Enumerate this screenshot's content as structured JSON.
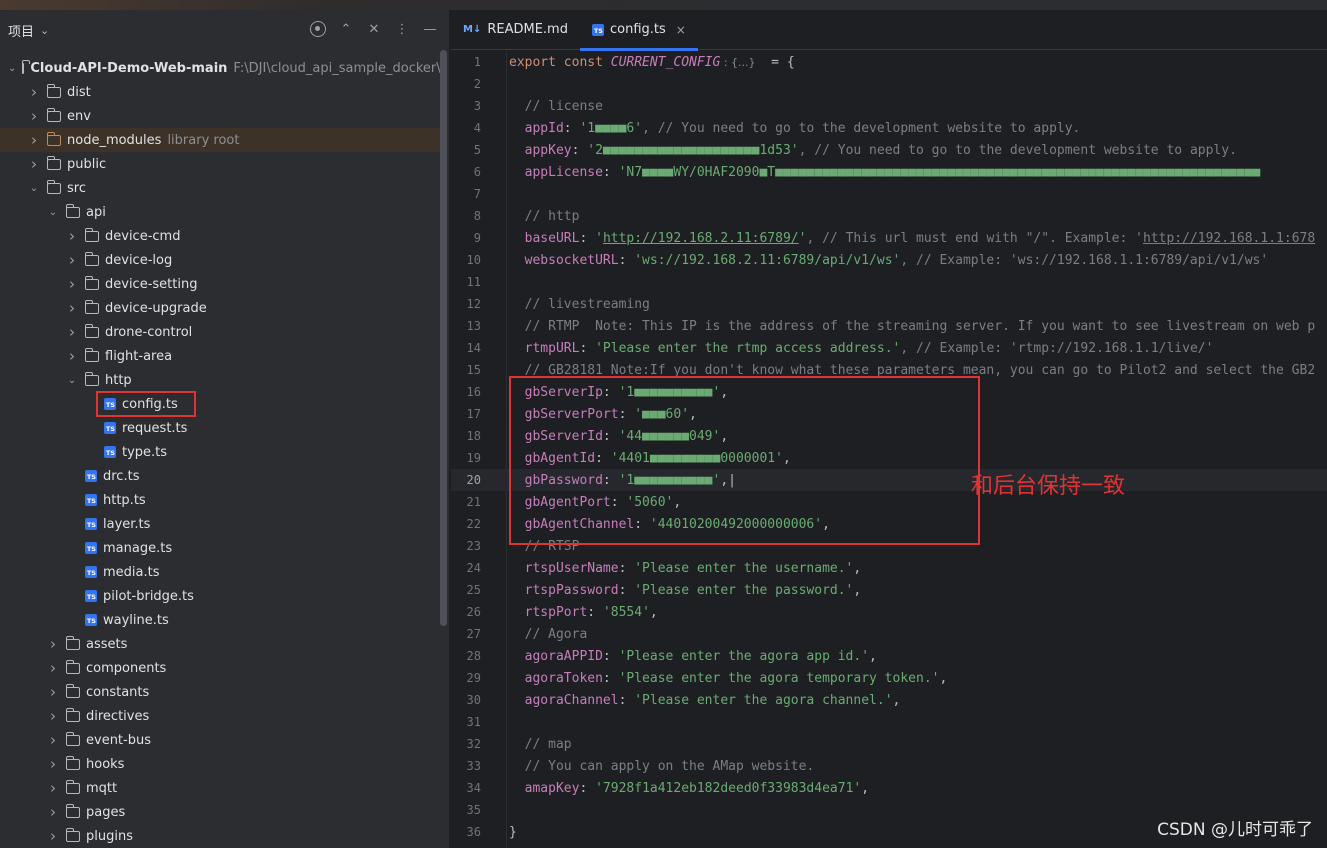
{
  "project_panel": {
    "title": "项目",
    "tree": [
      {
        "indent": 0,
        "arrow": "down",
        "icon": "folder",
        "label": "Cloud-API-Demo-Web-main",
        "bold": true,
        "extra": "F:\\DJI\\cloud_api_sample_docker\\clou"
      },
      {
        "indent": 1,
        "arrow": "right",
        "icon": "folder",
        "label": "dist"
      },
      {
        "indent": 1,
        "arrow": "right",
        "icon": "folder",
        "label": "env"
      },
      {
        "indent": 1,
        "arrow": "right",
        "icon": "folder-brown",
        "label": "node_modules",
        "extra": "library root",
        "selected": true
      },
      {
        "indent": 1,
        "arrow": "right",
        "icon": "folder",
        "label": "public"
      },
      {
        "indent": 1,
        "arrow": "down",
        "icon": "folder",
        "label": "src"
      },
      {
        "indent": 2,
        "arrow": "down",
        "icon": "folder",
        "label": "api"
      },
      {
        "indent": 3,
        "arrow": "right",
        "icon": "folder",
        "label": "device-cmd"
      },
      {
        "indent": 3,
        "arrow": "right",
        "icon": "folder",
        "label": "device-log"
      },
      {
        "indent": 3,
        "arrow": "right",
        "icon": "folder",
        "label": "device-setting"
      },
      {
        "indent": 3,
        "arrow": "right",
        "icon": "folder",
        "label": "device-upgrade"
      },
      {
        "indent": 3,
        "arrow": "right",
        "icon": "folder",
        "label": "drone-control"
      },
      {
        "indent": 3,
        "arrow": "right",
        "icon": "folder",
        "label": "flight-area"
      },
      {
        "indent": 3,
        "arrow": "down",
        "icon": "folder",
        "label": "http"
      },
      {
        "indent": 4,
        "arrow": "",
        "icon": "ts",
        "label": "config.ts",
        "boxed": true
      },
      {
        "indent": 4,
        "arrow": "",
        "icon": "ts",
        "label": "request.ts"
      },
      {
        "indent": 4,
        "arrow": "",
        "icon": "ts",
        "label": "type.ts"
      },
      {
        "indent": 3,
        "arrow": "",
        "icon": "ts",
        "label": "drc.ts"
      },
      {
        "indent": 3,
        "arrow": "",
        "icon": "ts",
        "label": "http.ts"
      },
      {
        "indent": 3,
        "arrow": "",
        "icon": "ts",
        "label": "layer.ts"
      },
      {
        "indent": 3,
        "arrow": "",
        "icon": "ts",
        "label": "manage.ts"
      },
      {
        "indent": 3,
        "arrow": "",
        "icon": "ts",
        "label": "media.ts"
      },
      {
        "indent": 3,
        "arrow": "",
        "icon": "ts",
        "label": "pilot-bridge.ts"
      },
      {
        "indent": 3,
        "arrow": "",
        "icon": "ts",
        "label": "wayline.ts"
      },
      {
        "indent": 2,
        "arrow": "right",
        "icon": "folder",
        "label": "assets"
      },
      {
        "indent": 2,
        "arrow": "right",
        "icon": "folder",
        "label": "components"
      },
      {
        "indent": 2,
        "arrow": "right",
        "icon": "folder",
        "label": "constants"
      },
      {
        "indent": 2,
        "arrow": "right",
        "icon": "folder",
        "label": "directives"
      },
      {
        "indent": 2,
        "arrow": "right",
        "icon": "folder",
        "label": "event-bus"
      },
      {
        "indent": 2,
        "arrow": "right",
        "icon": "folder",
        "label": "hooks"
      },
      {
        "indent": 2,
        "arrow": "right",
        "icon": "folder",
        "label": "mqtt"
      },
      {
        "indent": 2,
        "arrow": "right",
        "icon": "folder",
        "label": "pages"
      },
      {
        "indent": 2,
        "arrow": "right",
        "icon": "folder",
        "label": "plugins"
      }
    ]
  },
  "editor": {
    "tabs": [
      {
        "icon": "M↓",
        "label": "README.md",
        "active": false
      },
      {
        "icon": "TS",
        "label": "config.ts",
        "active": true,
        "close": "×"
      }
    ],
    "current_line": 20,
    "lines": [
      [
        {
          "t": "export const ",
          "c": "k"
        },
        {
          "t": "CURRENT_CONFIG",
          "c": "c"
        },
        {
          "t": " : {...}",
          "c": "hint"
        },
        {
          "t": "  = {",
          "c": "txt"
        }
      ],
      [],
      [
        {
          "t": "  // license",
          "c": "cm"
        }
      ],
      [
        {
          "t": "  appId",
          "c": "p"
        },
        {
          "t": ": ",
          "c": "txt"
        },
        {
          "t": "'1■■■■6'",
          "c": "s"
        },
        {
          "t": ", // You need to go to the development website to apply.",
          "c": "cm"
        }
      ],
      [
        {
          "t": "  appKey",
          "c": "p"
        },
        {
          "t": ": ",
          "c": "txt"
        },
        {
          "t": "'2■■■■■■■■■■■■■■■■■■■■1d53'",
          "c": "s"
        },
        {
          "t": ", // You need to go to the development website to apply.",
          "c": "cm"
        }
      ],
      [
        {
          "t": "  appLicense",
          "c": "p"
        },
        {
          "t": ": ",
          "c": "txt"
        },
        {
          "t": "'N7■■■■WY/0HAF2090■T■■■■■■■■■■■■■■■■■■■■■■■■■■■■■■■■■■■■■■■■■■■■■■■■■■■■■■■■■■■■■■",
          "c": "s"
        }
      ],
      [],
      [
        {
          "t": "  // http",
          "c": "cm"
        }
      ],
      [
        {
          "t": "  baseURL",
          "c": "p"
        },
        {
          "t": ": ",
          "c": "txt"
        },
        {
          "t": "'",
          "c": "s"
        },
        {
          "t": "http://192.168.2.11:6789/",
          "c": "s u"
        },
        {
          "t": "'",
          "c": "s"
        },
        {
          "t": ", // This url must end with \"/\". Example: '",
          "c": "cm"
        },
        {
          "t": "http://192.168.1.1:678",
          "c": "cm u"
        }
      ],
      [
        {
          "t": "  websocketURL",
          "c": "p"
        },
        {
          "t": ": ",
          "c": "txt"
        },
        {
          "t": "'ws://192.168.2.11:6789/api/v1/ws'",
          "c": "s"
        },
        {
          "t": ", // Example: 'ws://192.168.1.1:6789/api/v1/ws'",
          "c": "cm"
        }
      ],
      [],
      [
        {
          "t": "  // livestreaming",
          "c": "cm"
        }
      ],
      [
        {
          "t": "  // RTMP  Note: This IP is the address of the streaming server. If you want to see livestream on web p",
          "c": "cm"
        }
      ],
      [
        {
          "t": "  rtmpURL",
          "c": "p"
        },
        {
          "t": ": ",
          "c": "txt"
        },
        {
          "t": "'Please enter the rtmp access address.'",
          "c": "s"
        },
        {
          "t": ", // Example: 'rtmp://192.168.1.1/live/'",
          "c": "cm"
        }
      ],
      [
        {
          "t": "  // GB28181 Note:If you don't know what these parameters mean, you can go to Pilot2 and select the GB2",
          "c": "cm"
        }
      ],
      [
        {
          "t": "  gbServerIp",
          "c": "p"
        },
        {
          "t": ": ",
          "c": "txt"
        },
        {
          "t": "'1■■■■■■■■■■'",
          "c": "s"
        },
        {
          "t": ",",
          "c": "txt"
        }
      ],
      [
        {
          "t": "  gbServerPort",
          "c": "p"
        },
        {
          "t": ": ",
          "c": "txt"
        },
        {
          "t": "'■■■60'",
          "c": "s"
        },
        {
          "t": ",",
          "c": "txt"
        }
      ],
      [
        {
          "t": "  gbServerId",
          "c": "p"
        },
        {
          "t": ": ",
          "c": "txt"
        },
        {
          "t": "'44■■■■■■049'",
          "c": "s"
        },
        {
          "t": ",",
          "c": "txt"
        }
      ],
      [
        {
          "t": "  gbAgentId",
          "c": "p"
        },
        {
          "t": ": ",
          "c": "txt"
        },
        {
          "t": "'4401■■■■■■■■■0000001'",
          "c": "s"
        },
        {
          "t": ",",
          "c": "txt"
        }
      ],
      [
        {
          "t": "  gbPassword",
          "c": "p"
        },
        {
          "t": ": ",
          "c": "txt"
        },
        {
          "t": "'1■■■■■■■■■■'",
          "c": "s"
        },
        {
          "t": ",",
          "c": "txt"
        },
        {
          "t": "|",
          "c": "txt"
        }
      ],
      [
        {
          "t": "  gbAgentPort",
          "c": "p"
        },
        {
          "t": ": ",
          "c": "txt"
        },
        {
          "t": "'5060'",
          "c": "s"
        },
        {
          "t": ",",
          "c": "txt"
        }
      ],
      [
        {
          "t": "  gbAgentChannel",
          "c": "p"
        },
        {
          "t": ": ",
          "c": "txt"
        },
        {
          "t": "'44010200492000000006'",
          "c": "s"
        },
        {
          "t": ",",
          "c": "txt"
        }
      ],
      [
        {
          "t": "  // RTSP",
          "c": "cm"
        }
      ],
      [
        {
          "t": "  rtspUserName",
          "c": "p"
        },
        {
          "t": ": ",
          "c": "txt"
        },
        {
          "t": "'Please enter the username.'",
          "c": "s"
        },
        {
          "t": ",",
          "c": "txt"
        }
      ],
      [
        {
          "t": "  rtspPassword",
          "c": "p"
        },
        {
          "t": ": ",
          "c": "txt"
        },
        {
          "t": "'Please enter the password.'",
          "c": "s"
        },
        {
          "t": ",",
          "c": "txt"
        }
      ],
      [
        {
          "t": "  rtspPort",
          "c": "p"
        },
        {
          "t": ": ",
          "c": "txt"
        },
        {
          "t": "'8554'",
          "c": "s"
        },
        {
          "t": ",",
          "c": "txt"
        }
      ],
      [
        {
          "t": "  // Agora",
          "c": "cm"
        }
      ],
      [
        {
          "t": "  agoraAPPID",
          "c": "p"
        },
        {
          "t": ": ",
          "c": "txt"
        },
        {
          "t": "'Please enter the agora app id.'",
          "c": "s"
        },
        {
          "t": ",",
          "c": "txt"
        }
      ],
      [
        {
          "t": "  agoraToken",
          "c": "p"
        },
        {
          "t": ": ",
          "c": "txt"
        },
        {
          "t": "'Please enter the agora temporary token.'",
          "c": "s"
        },
        {
          "t": ",",
          "c": "txt"
        }
      ],
      [
        {
          "t": "  agoraChannel",
          "c": "p"
        },
        {
          "t": ": ",
          "c": "txt"
        },
        {
          "t": "'Please enter the agora channel.'",
          "c": "s"
        },
        {
          "t": ",",
          "c": "txt"
        }
      ],
      [],
      [
        {
          "t": "  // map",
          "c": "cm"
        }
      ],
      [
        {
          "t": "  // You can apply on the AMap website.",
          "c": "cm"
        }
      ],
      [
        {
          "t": "  amapKey",
          "c": "p"
        },
        {
          "t": ": ",
          "c": "txt"
        },
        {
          "t": "'7928f1a412eb182deed0f33983d4ea71'",
          "c": "s"
        },
        {
          "t": ",",
          "c": "txt"
        }
      ],
      [],
      [
        {
          "t": "}",
          "c": "txt"
        }
      ]
    ]
  },
  "annotation": "和后台保持一致",
  "watermark": "CSDN @儿时可乖了",
  "colors": {
    "accent": "#3574f0",
    "highlight_box": "#e03434",
    "string": "#6aab73",
    "property": "#c77dbb",
    "keyword": "#cf8e6d",
    "comment": "#7a7e85"
  }
}
